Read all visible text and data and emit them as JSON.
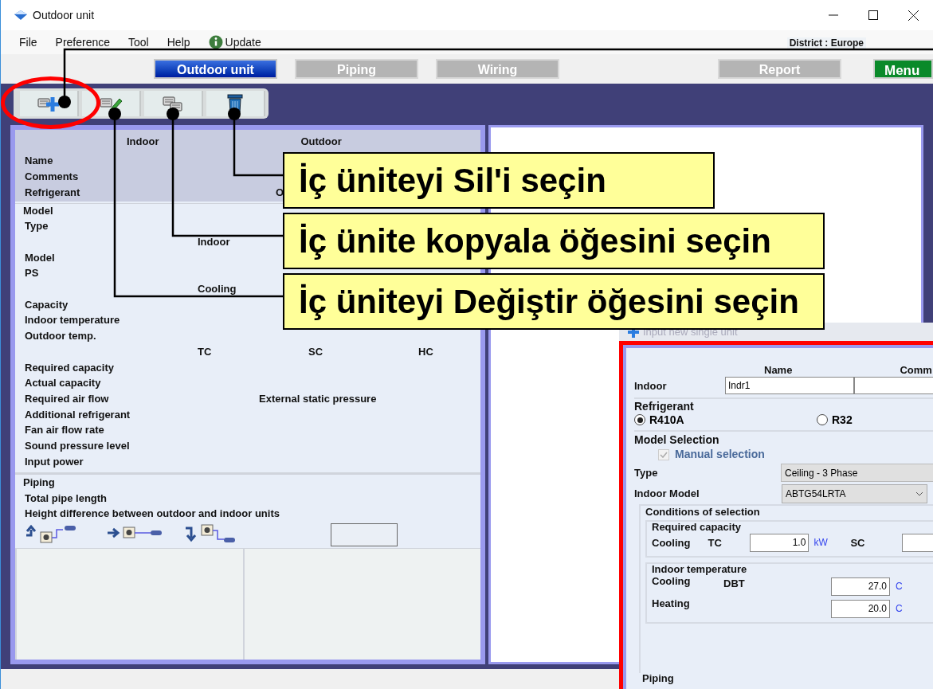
{
  "window": {
    "title": "Outdoor unit"
  },
  "menu": [
    {
      "label": "File",
      "kind": "plain"
    },
    {
      "label": "Preference",
      "kind": "plain"
    },
    {
      "label": "Tool",
      "kind": "plain"
    },
    {
      "label": "Help",
      "kind": "plain"
    },
    {
      "label": "Update",
      "kind": "info"
    }
  ],
  "district": "District : Europe",
  "nav_tabs": [
    {
      "label": "Outdoor unit",
      "selected": true
    },
    {
      "label": "Piping",
      "selected": false
    },
    {
      "label": "Wiring",
      "selected": false
    },
    {
      "label": "Report",
      "selected": false
    }
  ],
  "menu_button": "Menu",
  "toolbar": [
    {
      "kind": "add"
    },
    {
      "kind": "edit"
    },
    {
      "kind": "copy"
    },
    {
      "kind": "delete"
    }
  ],
  "summary": {
    "columns": [
      "Indoor",
      "Outdoor"
    ],
    "rows": [
      "Name",
      "Comments",
      "Refrigerant"
    ],
    "refrigerant_outdoor": "O"
  },
  "model_group": {
    "title": "Model",
    "rows": [
      {
        "label": "Type"
      },
      {
        "columns": [
          "Indoor"
        ]
      },
      {
        "label": "Model"
      },
      {
        "label": "PS"
      },
      {
        "columns": [
          "Cooling"
        ]
      },
      {
        "label": "Capacity"
      },
      {
        "label": "Indoor temperature"
      },
      {
        "label": "Outdoor temp."
      },
      {
        "columns": [
          "TC",
          "SC",
          "HC"
        ]
      },
      {
        "label": "Required capacity"
      },
      {
        "label": "Actual capacity"
      },
      {
        "label": "Required air flow",
        "extra": "External static pressure"
      },
      {
        "label": "Additional refrigerant"
      },
      {
        "label": "Fan air flow rate"
      },
      {
        "label": "Sound pressure level"
      },
      {
        "label": "Input power"
      }
    ]
  },
  "piping_group": {
    "title": "Piping",
    "rows": [
      "Total pipe length",
      "Height difference between outdoor and indoor units"
    ],
    "diagrams": [
      {
        "kind": "up"
      },
      {
        "kind": "level"
      },
      {
        "kind": "down"
      }
    ]
  },
  "highlight": {
    "kind": "add"
  },
  "callouts": [
    {
      "text": "İç üniteyi Sil'i seçin",
      "kind": "delete"
    },
    {
      "text": "İç ünite kopyala öğesini seçin",
      "kind": "copy"
    },
    {
      "text": "İç üniteyi Değiştir öğesini seçin",
      "kind": "edit"
    }
  ],
  "dialog": {
    "title": "Input new single unit",
    "name_header": "Name",
    "comments_header": "Comm",
    "indoor_label": "Indoor",
    "name_value": "Indr1",
    "refrigerant": {
      "title": "Refrigerant",
      "options": [
        {
          "label": "R410A",
          "selected": true
        },
        {
          "label": "R32",
          "selected": false
        }
      ]
    },
    "model_selection": {
      "title": "Model Selection",
      "manual": {
        "label": "Manual selection",
        "checked": true,
        "disabled": true
      },
      "type_label": "Type",
      "type_value": "Ceiling - 3 Phase",
      "model_label": "Indoor Model",
      "model_value": "ABTG54LRTA"
    },
    "conditions": {
      "title": "Conditions of selection",
      "required": {
        "title": "Required capacity",
        "label": "Cooling",
        "sub": "TC",
        "value": "1.0",
        "unit": "kW",
        "second": "SC"
      },
      "indoor_temp": {
        "title": "Indoor temperature",
        "rows": [
          {
            "label": "Cooling",
            "sub": "DBT",
            "value": "27.0",
            "unit": "C"
          },
          {
            "label": "Heating",
            "value": "20.0",
            "unit": "C"
          }
        ]
      }
    },
    "piping_title": "Piping"
  }
}
